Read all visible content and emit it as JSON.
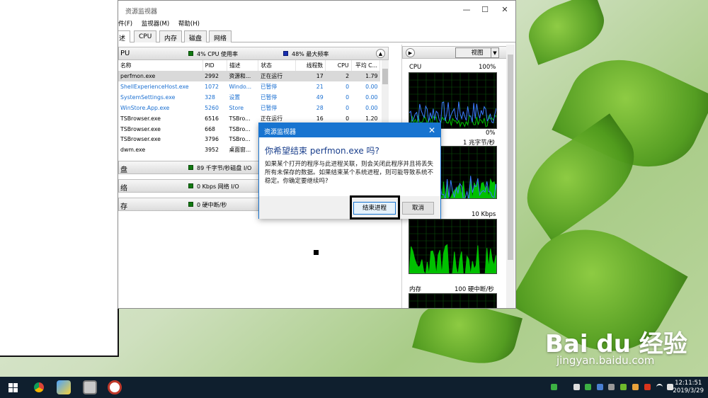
{
  "window": {
    "title": "资源监视器",
    "controls": {
      "minimize": "—",
      "maximize": "☐",
      "close": "✕"
    }
  },
  "menu": [
    "件(F)",
    "监视器(M)",
    "帮助(H)"
  ],
  "tabs": [
    "述",
    "CPU",
    "内存",
    "磁盘",
    "网络"
  ],
  "cpu_section": {
    "label": "PU",
    "usage": "4% CPU 使用率",
    "freq": "48% 最大频率",
    "columns": [
      "名称",
      "PID",
      "描述",
      "状态",
      "线程数",
      "CPU",
      "平均 C..."
    ],
    "rows": [
      {
        "name": "perfmon.exe",
        "pid": "2992",
        "desc": "资源和...",
        "status": "正在运行",
        "threads": "17",
        "cpu": "2",
        "avg": "1.79",
        "selected": true,
        "suspended": false
      },
      {
        "name": "ShellExperienceHost.exe",
        "pid": "1072",
        "desc": "Windo...",
        "status": "已暂停",
        "threads": "21",
        "cpu": "0",
        "avg": "0.00",
        "selected": false,
        "suspended": true
      },
      {
        "name": "SystemSettings.exe",
        "pid": "328",
        "desc": "设置",
        "status": "已暂停",
        "threads": "49",
        "cpu": "0",
        "avg": "0.00",
        "selected": false,
        "suspended": true
      },
      {
        "name": "WinStore.App.exe",
        "pid": "5260",
        "desc": "Store",
        "status": "已暂停",
        "threads": "28",
        "cpu": "0",
        "avg": "0.00",
        "selected": false,
        "suspended": true
      },
      {
        "name": "TSBrowser.exe",
        "pid": "6516",
        "desc": "TSBro...",
        "status": "正在运行",
        "threads": "16",
        "cpu": "0",
        "avg": "1.20",
        "selected": false,
        "suspended": false
      },
      {
        "name": "TSBrowser.exe",
        "pid": "668",
        "desc": "TSBro...",
        "status": "",
        "threads": "",
        "cpu": "",
        "avg": "",
        "selected": false,
        "suspended": false
      },
      {
        "name": "TSBrowser.exe",
        "pid": "3796",
        "desc": "TSBro...",
        "status": "",
        "threads": "",
        "cpu": "",
        "avg": "",
        "selected": false,
        "suspended": false
      },
      {
        "name": "dwm.exe",
        "pid": "3952",
        "desc": "桌面窗...",
        "status": "",
        "threads": "",
        "cpu": "",
        "avg": "",
        "selected": false,
        "suspended": false
      }
    ]
  },
  "disk_section": {
    "label": "盘",
    "stat": "89 千字节/秒磁盘 I/O"
  },
  "net_section": {
    "label": "络",
    "stat": "0 Kbps 网络 I/O"
  },
  "mem_section": {
    "label": "存",
    "stat": "0 硬中断/秒"
  },
  "graphs": {
    "view_label": "视图",
    "cpu": {
      "label": "CPU",
      "max": "100%",
      "min": "0%"
    },
    "disk": {
      "max": "1 兆字节/秒"
    },
    "net": {
      "max": "10 Kbps"
    },
    "mem": {
      "label": "内存",
      "max": "100 硬中断/秒"
    }
  },
  "dialog": {
    "title": "资源监视器",
    "question": "你希望结束 perfmon.exe 吗?",
    "message": "如果某个打开的程序与此进程关联，则会关闭此程序并且将丢失所有未保存的数据。如果结束某个系统进程，则可能导致系统不稳定。你确定要继续吗?",
    "confirm_button": "结束进程",
    "cancel_button": "取消"
  },
  "taskbar": {
    "time": "12:11:51",
    "date": "2019/3/29"
  },
  "watermark": {
    "brand": "Bai du 经验",
    "url": "jingyan.baidu.com"
  },
  "colors": {
    "accent": "#1874d0",
    "graph_green": "#00c000",
    "graph_blue": "#3a7bff",
    "taskbar": "#0f1f2e"
  }
}
